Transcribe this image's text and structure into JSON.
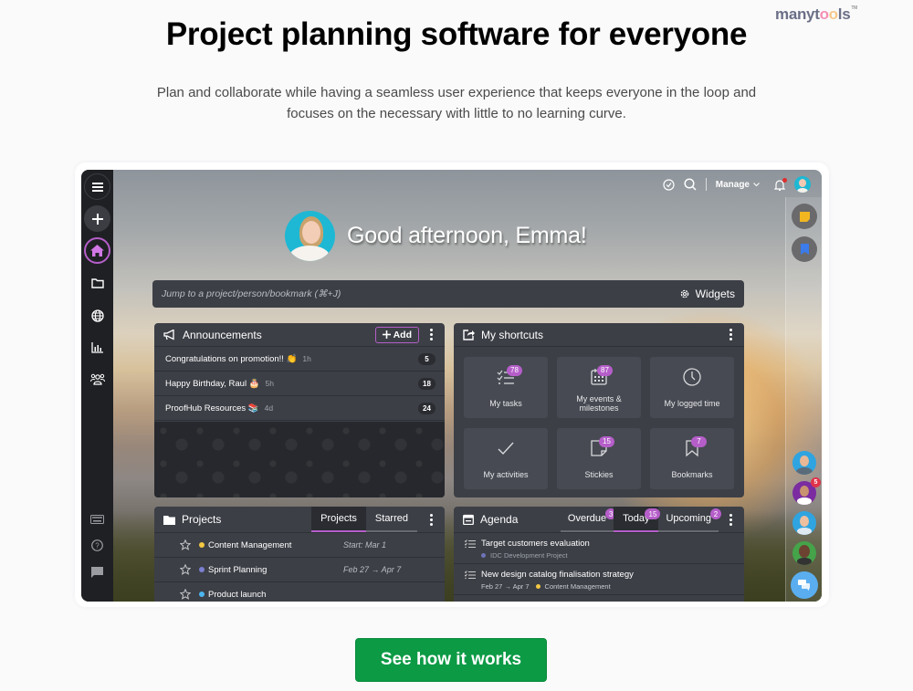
{
  "brand": {
    "logo_text_a": "manyt",
    "logo_o1": "o",
    "logo_o2": "o",
    "logo_text_b": "ls",
    "logo_tm": "TM"
  },
  "hero": {
    "title": "Project planning software for everyone",
    "subtitle": "Plan and collaborate while having a seamless user experience that keeps everyone in the loop and focuses on the necessary with little to no learning curve."
  },
  "app": {
    "rail": {
      "menu_icon": "hamburger-icon",
      "add_icon": "plus-icon",
      "home_icon": "home-icon",
      "items": [
        "folder-icon",
        "globe-icon",
        "reports-icon",
        "people-icon"
      ],
      "bottom": [
        "keyboard-icon",
        "help-icon",
        "chat-icon"
      ]
    },
    "topbar": {
      "manage_label": "Manage",
      "timer_icon": "timer-icon",
      "search_icon": "search-icon",
      "bell_icon": "bell-icon"
    },
    "greeting": "Good afternoon, Emma!",
    "jump": {
      "placeholder": "Jump to a project/person/bookmark (⌘+J)",
      "widgets_label": "Widgets"
    },
    "announcements": {
      "title": "Announcements",
      "add_label": "Add",
      "items": [
        {
          "text": "Congratulations on promotion!!",
          "emoji": "👏",
          "time": "1h",
          "count": "5"
        },
        {
          "text": "Happy Birthday, Raul",
          "emoji": "🎂",
          "time": "5h",
          "count": "18"
        },
        {
          "text": "ProofHub Resources",
          "emoji": "📚",
          "time": "4d",
          "count": "24"
        }
      ]
    },
    "shortcuts": {
      "title": "My shortcuts",
      "items": [
        {
          "label": "My tasks",
          "badge": "78",
          "icon": "tasks-icon"
        },
        {
          "label": "My events & milestones",
          "badge": "87",
          "icon": "calendar-icon"
        },
        {
          "label": "My logged time",
          "badge": "",
          "icon": "clock-icon"
        },
        {
          "label": "My activities",
          "badge": "",
          "icon": "check-icon"
        },
        {
          "label": "Stickies",
          "badge": "15",
          "icon": "sticky-note-icon"
        },
        {
          "label": "Bookmarks",
          "badge": "7",
          "icon": "bookmark-icon"
        }
      ]
    },
    "projects": {
      "title": "Projects",
      "tabs": [
        "Projects",
        "Starred"
      ],
      "active_tab": "Projects",
      "rows": [
        {
          "name": "Content Management",
          "color": "#f5c842",
          "dates": "Start: Mar 1"
        },
        {
          "name": "Sprint Planning",
          "color": "#7b7fd0",
          "dates": "Feb 27 → Apr 7"
        },
        {
          "name": "Product launch",
          "color": "#4db6f0",
          "dates": ""
        }
      ]
    },
    "agenda": {
      "title": "Agenda",
      "tabs": [
        {
          "label": "Overdue",
          "count": "3"
        },
        {
          "label": "Today",
          "count": "15"
        },
        {
          "label": "Upcoming",
          "count": "2"
        }
      ],
      "active_tab": "Today",
      "rows": [
        {
          "title": "Target customers evaluation",
          "dates": "",
          "project": "IDC Development Project",
          "color": "#6f74b8"
        },
        {
          "title": "New design catalog finalisation strategy",
          "dates": "Feb 27 → Apr 7",
          "project": "Content Management",
          "color": "#f5c842"
        }
      ]
    },
    "side_panel": {
      "sticky_icon": "sticky-note-icon",
      "bookmark_icon": "bookmark-icon",
      "unread_badge": "5",
      "chat_icon": "chat-bubbles-icon"
    }
  },
  "cta": {
    "label": "See how it works"
  },
  "colors": {
    "accent": "#b55ec9",
    "cta": "#0c9a45",
    "panel": "#3c3f46",
    "rail": "#1f2024"
  }
}
